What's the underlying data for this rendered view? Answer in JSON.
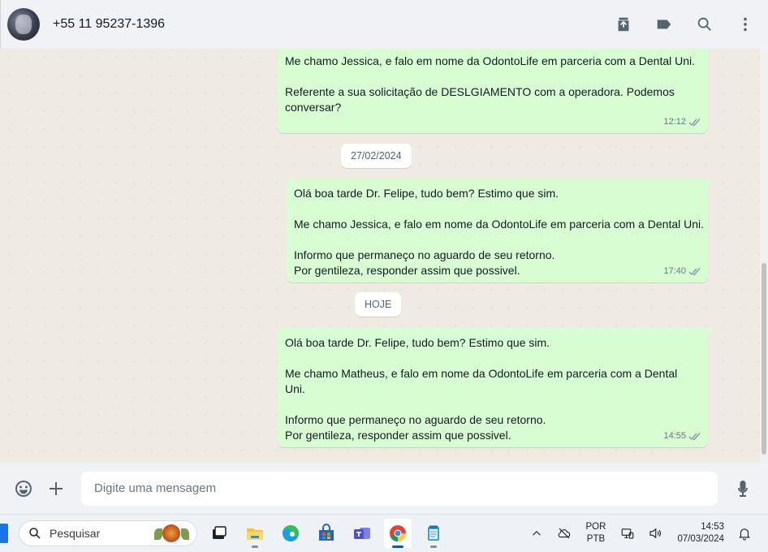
{
  "header": {
    "contact_name": "+55 11 95237-1396",
    "icons": [
      "archive-icon",
      "label-icon",
      "search-icon",
      "menu-icon"
    ]
  },
  "messages": [
    {
      "lines": [
        "Me chamo Jessica, e falo em nome da OdontoLife em parceria com a Dental Uni.",
        "",
        "Referente a sua solicitação de DESLGIAMENTO com a operadora. Podemos",
        "conversar?"
      ],
      "time": "12:12",
      "status": "read"
    },
    {
      "lines": [
        "Olá boa tarde Dr. Felipe, tudo bem? Estimo que sim.",
        "",
        "Me chamo Jessica, e falo em nome da OdontoLife em parceria com a Dental Uni.",
        "",
        "Informo que permaneço no aguardo de seu retorno.",
        "Por gentileza, responder assim que possivel."
      ],
      "time": "17:40",
      "status": "read"
    },
    {
      "lines": [
        "Olá boa tarde Dr. Felipe, tudo bem? Estimo que sim.",
        "",
        "Me chamo Matheus, e falo em nome da OdontoLife em parceria com a Dental",
        "Uni.",
        "",
        "Informo que permaneço no aguardo de seu retorno.",
        "Por gentileza, responder assim que possivel."
      ],
      "time": "14:55",
      "status": "read"
    }
  ],
  "date_separators": [
    "27/02/2024",
    "HOJE"
  ],
  "composer": {
    "placeholder": "Digite uma mensagem"
  },
  "taskbar": {
    "search_label": "Pesquisar",
    "language": "POR",
    "layout": "PTB",
    "time": "14:53",
    "date": "07/03/2024"
  }
}
